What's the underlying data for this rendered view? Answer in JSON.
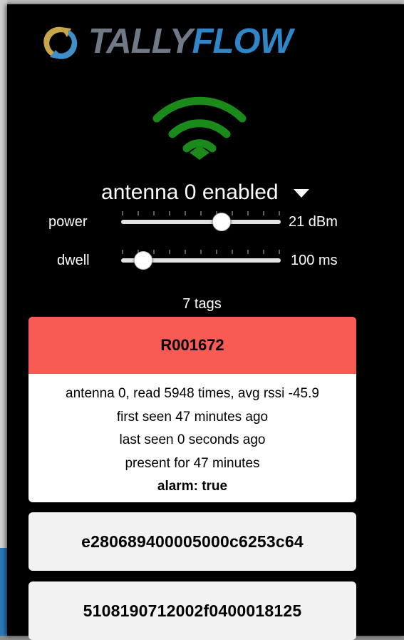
{
  "brand": {
    "tally": "TALLY",
    "flow": "FLOW"
  },
  "status": {
    "wifi_icon": "wifi-icon",
    "color": "#1a8a1a"
  },
  "antenna": {
    "label": "antenna 0 enabled"
  },
  "sliders": {
    "power": {
      "label": "power",
      "value": "21 dBm",
      "fraction": 0.63
    },
    "dwell": {
      "label": "dwell",
      "value": "100 ms",
      "fraction": 0.14
    }
  },
  "tags": {
    "count_label": "7 tags",
    "items": [
      {
        "id": "R001672",
        "alarm_color": "#f85a54",
        "details": [
          "antenna 0, read 5948 times, avg rssi -45.9",
          "first seen 47 minutes ago",
          "last seen 0 seconds ago",
          "present for 47 minutes"
        ],
        "alarm_text": "alarm: true"
      },
      {
        "id": "e280689400005000c6253c64"
      },
      {
        "id": "5108190712002f0400018125"
      }
    ]
  }
}
